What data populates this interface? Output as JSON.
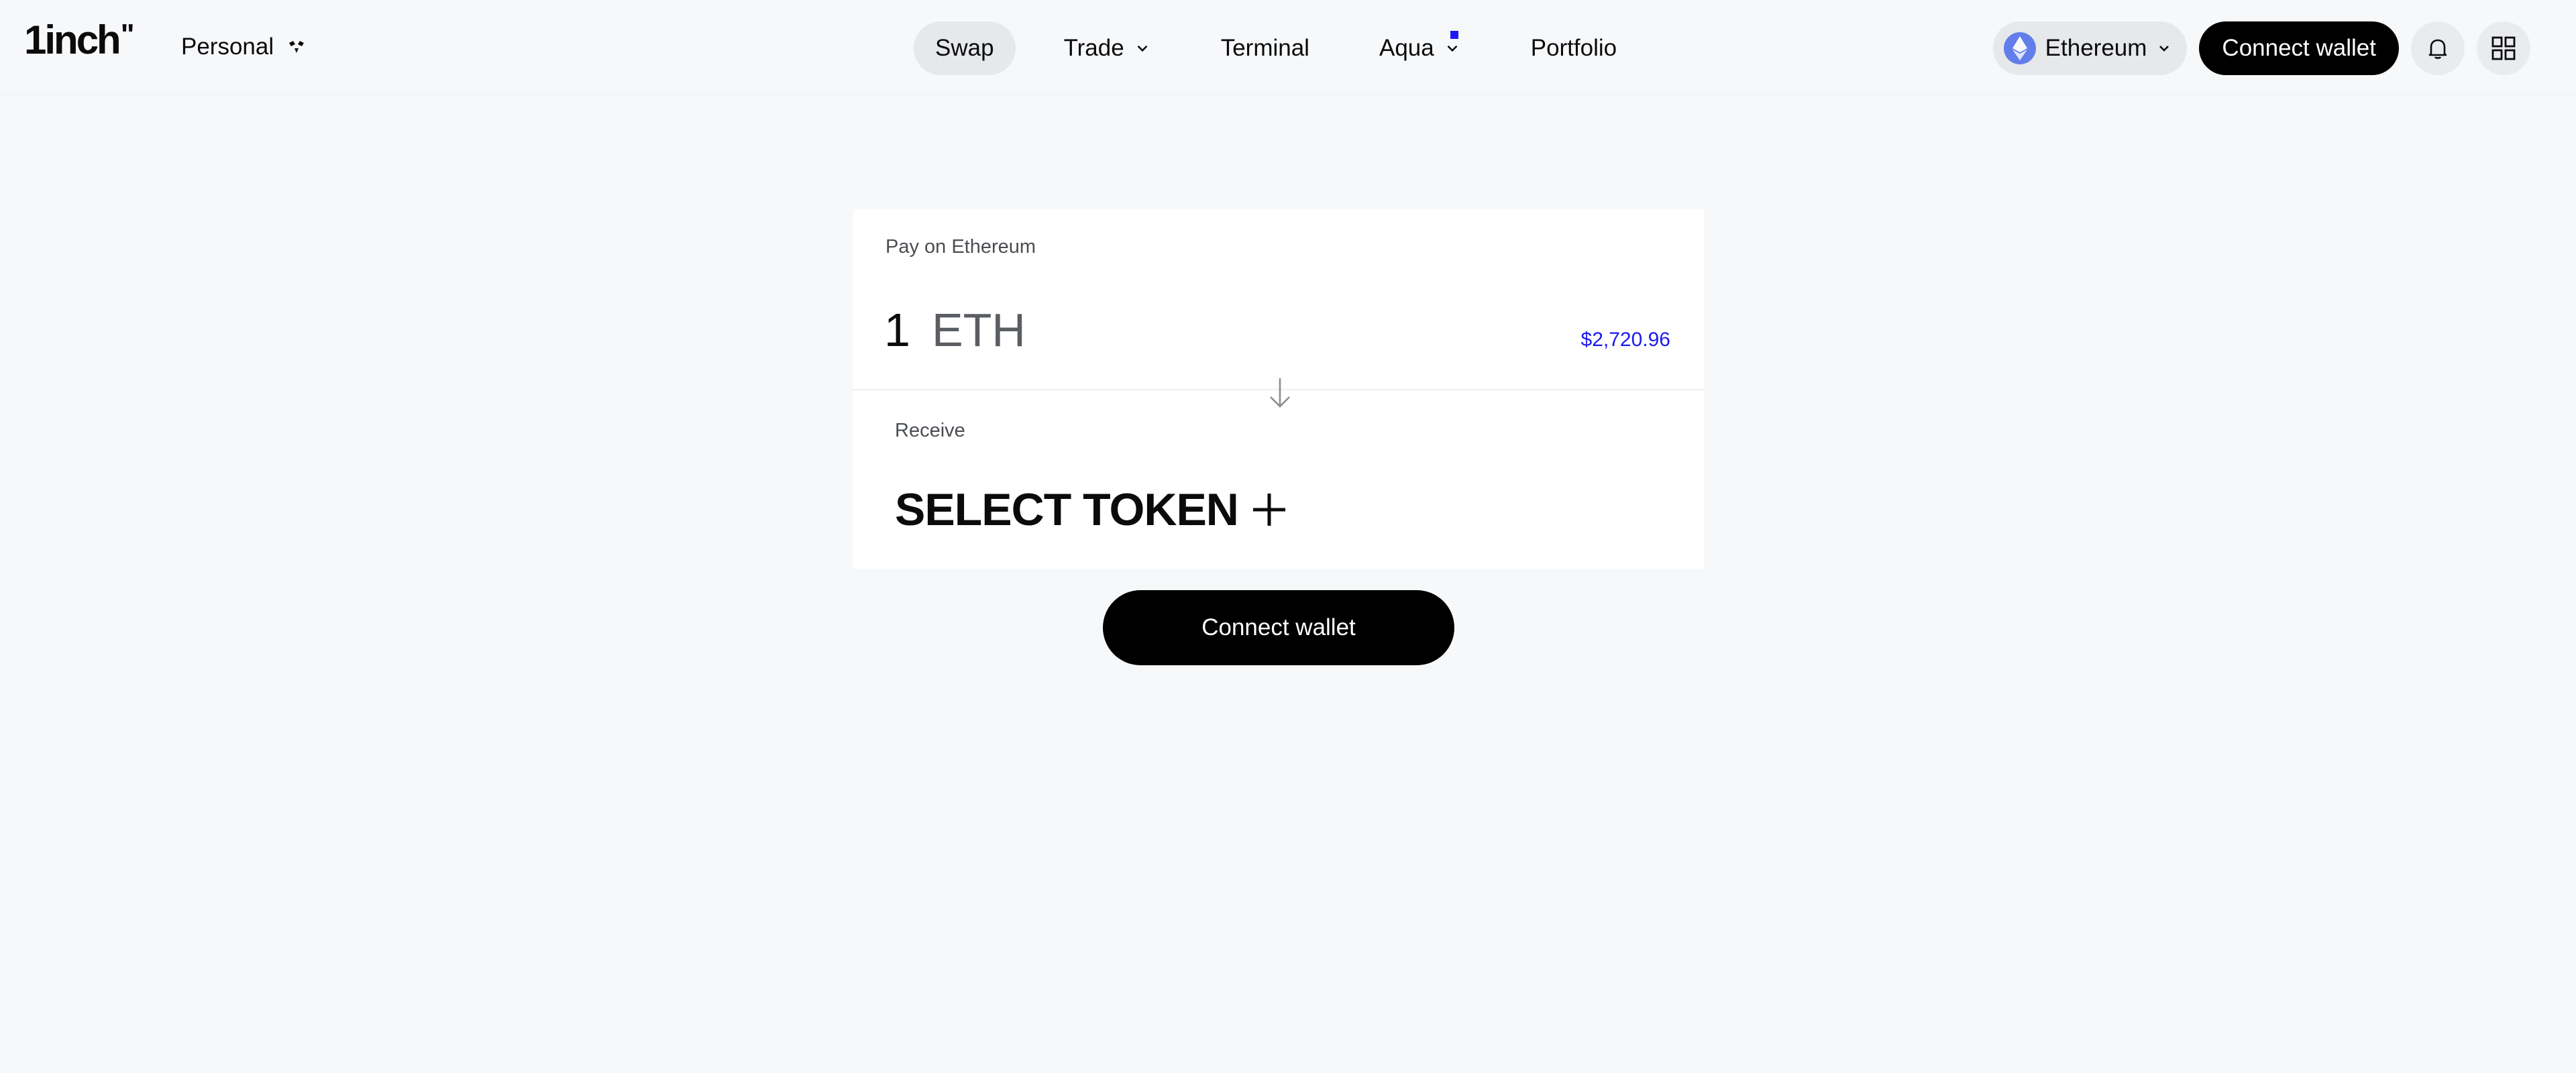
{
  "header": {
    "logo_text": "1inch",
    "logo_mark": "\"",
    "mode_label": "Personal",
    "nav": {
      "swap": "Swap",
      "trade": "Trade",
      "terminal": "Terminal",
      "aqua": "Aqua",
      "portfolio": "Portfolio"
    },
    "network_label": "Ethereum",
    "connect_label": "Connect wallet"
  },
  "swap": {
    "pay_label": "Pay on Ethereum",
    "amount": "1",
    "pay_token": "ETH",
    "usd_value": "$2,720.96",
    "receive_label": "Receive",
    "select_token_label": "SELECT TOKEN",
    "connect_label": "Connect wallet"
  },
  "colors": {
    "accent": "#1b1bf0",
    "background": "#f7f8fa",
    "card": "#ffffff",
    "button": "#000000",
    "eth": "#627eea"
  }
}
